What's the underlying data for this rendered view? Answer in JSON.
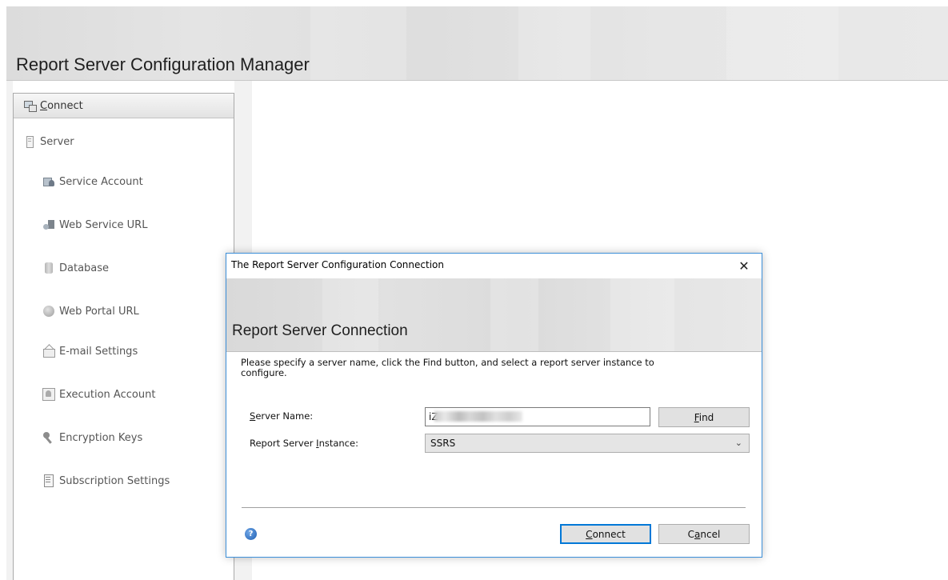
{
  "app": {
    "title": "Report Server Configuration Manager"
  },
  "sidebar": {
    "connect_label": [
      "C",
      "onnect"
    ],
    "items": [
      {
        "label": "Server",
        "icon": "server-icon"
      },
      {
        "label": "Service Account",
        "icon": "service-account-icon"
      },
      {
        "label": "Web Service URL",
        "icon": "web-service-icon"
      },
      {
        "label": "Database",
        "icon": "database-icon"
      },
      {
        "label": "Web Portal URL",
        "icon": "globe-icon"
      },
      {
        "label": "E-mail Settings",
        "icon": "email-icon"
      },
      {
        "label": "Execution Account",
        "icon": "execution-account-icon"
      },
      {
        "label": "Encryption Keys",
        "icon": "keys-icon"
      },
      {
        "label": "Subscription Settings",
        "icon": "subscription-icon"
      }
    ]
  },
  "dialog": {
    "title": "The Report Server Configuration Connection",
    "close_glyph": "✕",
    "heading": "Report Server Connection",
    "instructions": "Please specify a server name, click the Find button, and select a report server instance to configure.",
    "server_name_label": [
      "S",
      "erver Name:"
    ],
    "server_name_value": "iZ",
    "find_button": [
      "F",
      "ind"
    ],
    "instance_label": [
      "Report Server ",
      "I",
      "nstance:"
    ],
    "instance_value": "SSRS",
    "help_glyph": "?",
    "connect_button": [
      "C",
      "onnect"
    ],
    "cancel_button": [
      "C",
      "a",
      "ncel"
    ]
  },
  "colors": {
    "dialog_border": "#3c8fd9",
    "default_button_border": "#0078d7",
    "help_icon": "#1f5fb3"
  }
}
